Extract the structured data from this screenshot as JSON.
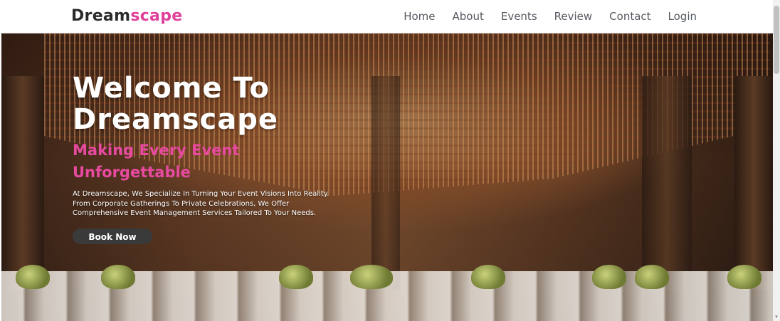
{
  "navbar": {
    "brand_part1": "Dream",
    "brand_part2": "scape",
    "links": [
      "Home",
      "About",
      "Events",
      "Review",
      "Contact",
      "Login"
    ]
  },
  "hero": {
    "title_line1": "Welcome To",
    "title_line2": "Dreamscape",
    "subtitle": "Making Every Event Unforgettable",
    "description": "At Dreamscape, We Specialize In Turning Your Event Visions Into Reality. From Corporate Gatherings To Private Celebrations, We Offer Comprehensive Event Management Services Tailored To Your Needs.",
    "cta_label": "Book Now"
  },
  "colors": {
    "accent": "#e0409a",
    "brand_dark": "#2b2b2b",
    "button_bg": "#3a3a3a"
  }
}
